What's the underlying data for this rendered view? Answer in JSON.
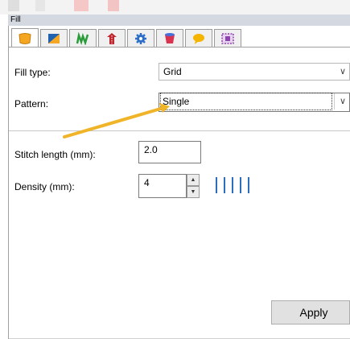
{
  "panel": {
    "title": "Fill"
  },
  "tabs": [
    {
      "icon": "fill-shape-icon",
      "color": "#f5a623",
      "active": true
    },
    {
      "icon": "fill-pattern-icon",
      "color": "#1e62b0"
    },
    {
      "icon": "motif-fill-icon",
      "color": "#2a9d3a"
    },
    {
      "icon": "applique-icon",
      "color": "#c0262d"
    },
    {
      "icon": "settings-gear-icon",
      "color": "#2d6fc7"
    },
    {
      "icon": "color-cup-icon",
      "color": "#d9344f"
    },
    {
      "icon": "speech-bubble-icon",
      "color": "#f4b400"
    },
    {
      "icon": "grid-select-icon",
      "color": "#8e44ad"
    }
  ],
  "fields": {
    "fill_type": {
      "label": "Fill type:",
      "value": "Grid"
    },
    "pattern": {
      "label": "Pattern:",
      "value": "Single"
    },
    "stitch_length": {
      "label": "Stitch length (mm):",
      "value": "2.0"
    },
    "density": {
      "label": "Density (mm):",
      "value": "4"
    }
  },
  "buttons": {
    "apply": "Apply"
  },
  "colors": {
    "header_bg": "#d4d8e0",
    "annotation_arrow": "#f0b429",
    "density_preview": "#2c6dbf"
  }
}
